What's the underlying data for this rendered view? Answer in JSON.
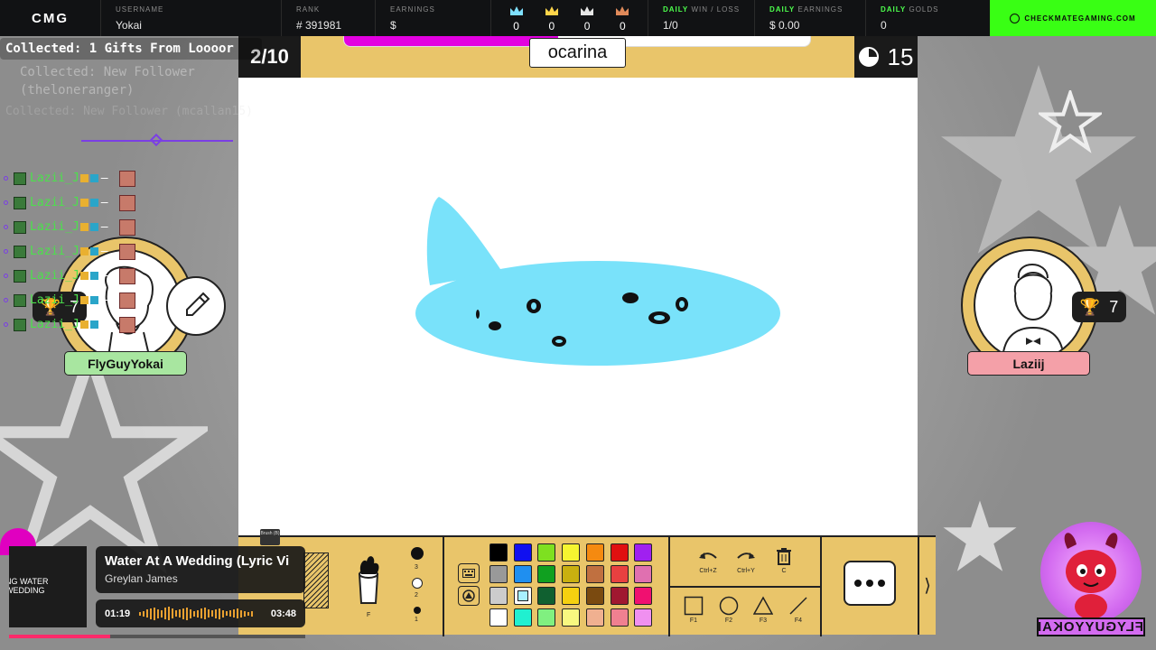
{
  "topbar": {
    "logo": "CMG",
    "username_label": "USERNAME",
    "username": "Yokai",
    "rank_label": "RANK",
    "rank": "# 391981",
    "earnings_label": "EARNINGS",
    "earnings": "$",
    "crowns": [
      {
        "color": "#7fe0ff",
        "value": "0"
      },
      {
        "color": "#ffd54a",
        "value": "0"
      },
      {
        "color": "#e6e6e6",
        "value": "0"
      },
      {
        "color": "#e08a5a",
        "value": "0"
      }
    ],
    "daily_winloss_label_a": "DAILY",
    "daily_winloss_label_b": " WIN / LOSS",
    "daily_winloss": "1/0",
    "daily_earnings_label_a": "DAILY",
    "daily_earnings_label_b": " EARNINGS",
    "daily_earnings": "$ 0.00",
    "daily_golds_label_a": "DAILY",
    "daily_golds_label_b": " GOLDS",
    "daily_golds": "0",
    "site": "CHECKMATEGAMING.COM"
  },
  "game": {
    "round": "2/10",
    "word": "ocarina",
    "time_left": "15",
    "word_progress_fraction": 0.46
  },
  "players": {
    "left": {
      "name": "FlyGuyYokai",
      "trophies": "7",
      "tag_color": "#a8e6a0"
    },
    "right": {
      "name": "Laziij",
      "trophies": "7",
      "tag_color": "#f4a0a8"
    }
  },
  "toolbar": {
    "brush_tag": "Brush (B)",
    "fill_key": "F",
    "sizes": [
      "3",
      "2",
      "1"
    ],
    "palette": [
      [
        "#000000",
        "#1010f0",
        "#7ee020",
        "#f5f530",
        "#f58a10",
        "#e01010",
        "#a020f0"
      ],
      [
        "#999999",
        "#1f8ff0",
        "#10a020",
        "#c9b010",
        "#c07040",
        "#e84040",
        "#e070b0"
      ],
      [
        "#cccccc",
        "#a8f0ff",
        "#106030",
        "#f5d010",
        "#7a4a10",
        "#a01830",
        "#f01070"
      ],
      [
        "#ffffff",
        "#20f0d0",
        "#80f080",
        "#f8f880",
        "#f0b090",
        "#f08090",
        "#f090f0"
      ]
    ],
    "selected_color": "#a8f0ff",
    "undo_key": "Ctrl+Z",
    "redo_key": "Ctrl+Y",
    "clear_key": "C",
    "shape_keys": [
      "F1",
      "F2",
      "F3",
      "F4"
    ]
  },
  "overlay": {
    "alert1": "Collected: 1 Gifts From Loooor",
    "alert2": "Collected: New Follower (theloneranger)",
    "alert3": "Collected: New Follower (mcallan15)",
    "chat_rows": [
      "Lazii_J",
      "Lazii_J",
      "Lazii_J",
      "Lazii_J",
      "Lazii_J",
      "Lazii_J",
      "Lazii_J"
    ],
    "np_art_line1": "NG WATER",
    "np_art_line2": "WEDDING",
    "np_title": "Water At A Wedding (Lyric Vi",
    "np_artist": "Greylan James",
    "np_elapsed": "01:19",
    "np_total": "03:48",
    "np_progress_fraction": 0.34,
    "logo_text": "FLYGUYYOKAI"
  }
}
